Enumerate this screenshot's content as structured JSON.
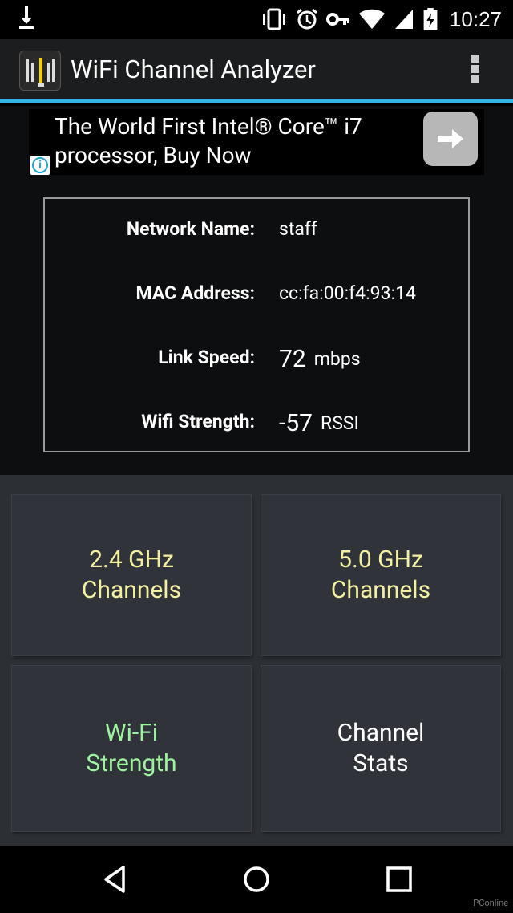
{
  "status_bar": {
    "time": "10:27",
    "icons": [
      "download-icon",
      "vibrate-icon",
      "alarm-icon",
      "vpn-key-icon",
      "wifi-icon",
      "signal-icon",
      "battery-charging-icon"
    ]
  },
  "app": {
    "title": "WiFi Channel Analyzer",
    "accent_color": "#33b5e5"
  },
  "ad": {
    "text": "The World First Intel® Core™ i7 processor, Buy Now",
    "info_label": "i"
  },
  "network_info": {
    "name_label": "Network Name:",
    "name_value": "staff",
    "mac_label": "MAC Address:",
    "mac_value": "cc:fa:00:f4:93:14",
    "speed_label": "Link Speed:",
    "speed_value": "72",
    "speed_unit": "mbps",
    "strength_label": "Wifi Strength:",
    "strength_value": "-57",
    "strength_unit": "RSSI"
  },
  "tiles": {
    "t1_line1": "2.4 GHz",
    "t1_line2": "Channels",
    "t2_line1": "5.0 GHz",
    "t2_line2": "Channels",
    "t3_line1": "Wi-Fi",
    "t3_line2": "Strength",
    "t4_line1": "Channel",
    "t4_line2": "Stats"
  },
  "watermark": "PConline"
}
